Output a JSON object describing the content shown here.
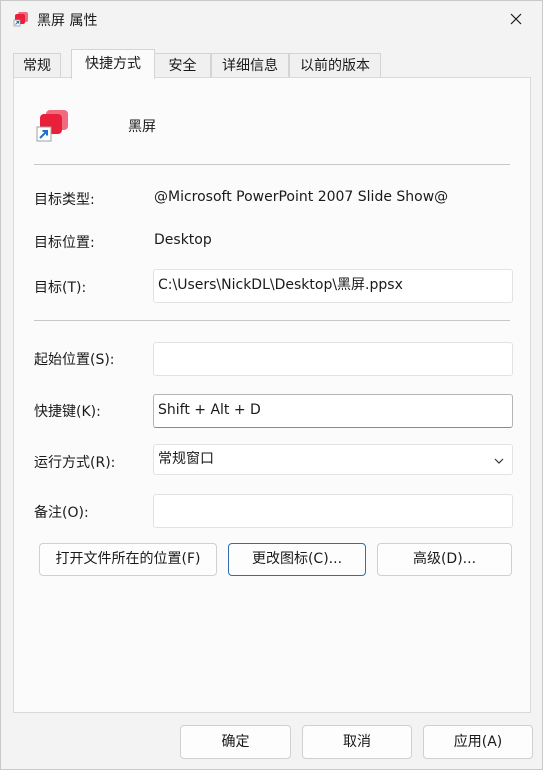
{
  "window": {
    "title": "黑屏 属性"
  },
  "tabs": [
    {
      "label": "常规"
    },
    {
      "label": "快捷方式"
    },
    {
      "label": "安全"
    },
    {
      "label": "详细信息"
    },
    {
      "label": "以前的版本"
    }
  ],
  "active_tab": "快捷方式",
  "shortcut": {
    "file_name": "黑屏",
    "target_type_label": "目标类型:",
    "target_type_value": "@Microsoft PowerPoint 2007 Slide Show@",
    "target_location_label": "目标位置:",
    "target_location_value": "Desktop",
    "target_label": "目标(T):",
    "target_value": "C:\\Users\\NickDL\\Desktop\\黑屏.ppsx",
    "start_in_label": "起始位置(S):",
    "start_in_value": "",
    "hotkey_label": "快捷键(K):",
    "hotkey_value": "Shift + Alt + D",
    "run_label": "运行方式(R):",
    "run_value": "常规窗口",
    "comment_label": "备注(O):",
    "comment_value": "",
    "open_location_button": "打开文件所在的位置(F)",
    "change_icon_button": "更改图标(C)...",
    "advanced_button": "高级(D)..."
  },
  "footer": {
    "ok": "确定",
    "cancel": "取消",
    "apply": "应用(A)"
  },
  "colors": {
    "icon_red": "#e8203a",
    "icon_pink": "#f06a80",
    "shortcut_arrow": "#1f6fd0",
    "default_button_border": "#2f6fb1"
  },
  "icons": {
    "title": "slideshow-file-icon",
    "close": "close-icon",
    "file": "slideshow-shortcut-icon",
    "dropdown": "chevron-down-icon"
  }
}
